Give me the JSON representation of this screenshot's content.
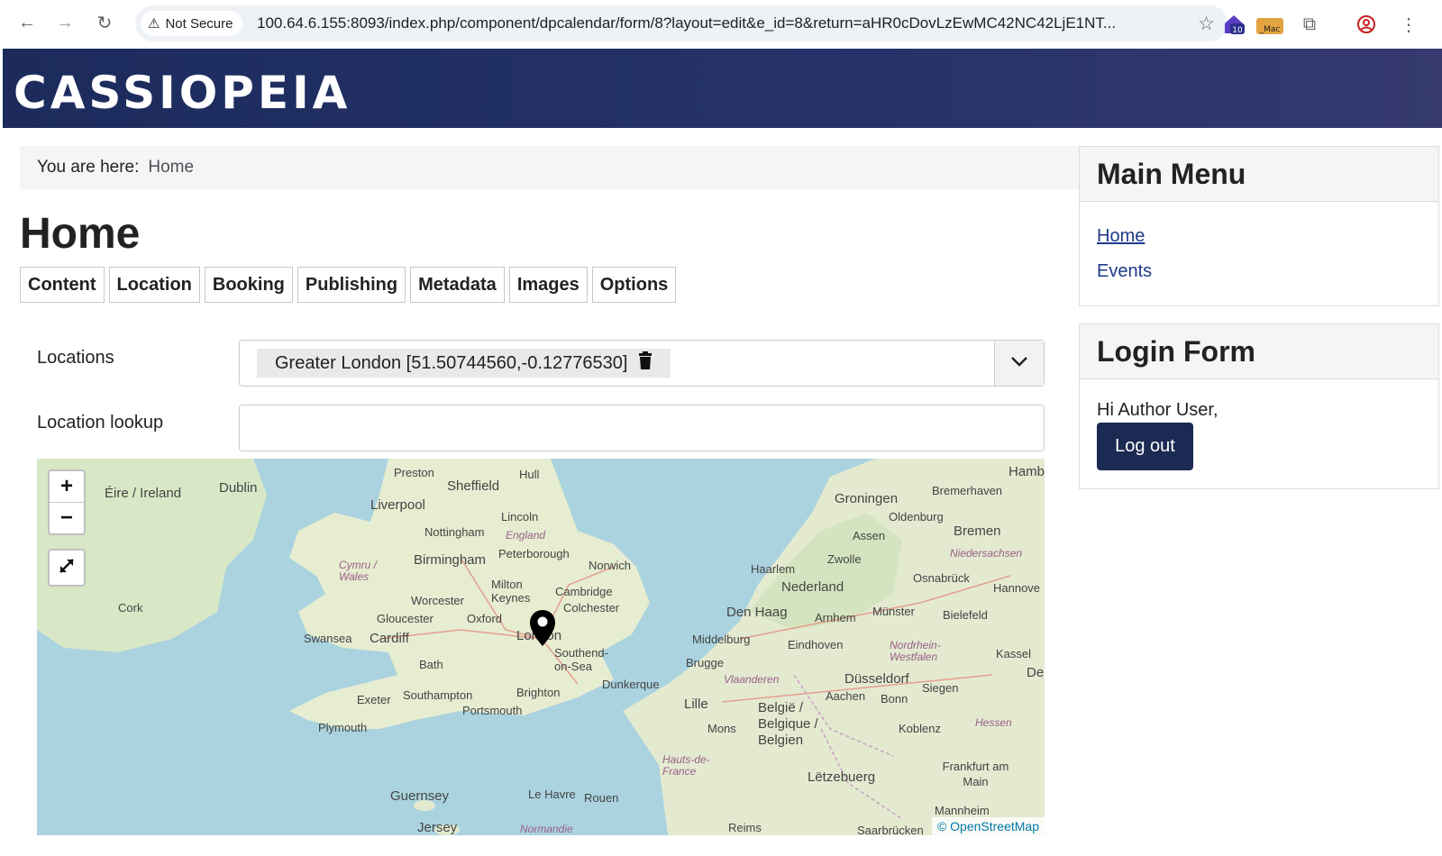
{
  "browser": {
    "security_label": "Not Secure",
    "url": "100.64.6.155:8093/index.php/component/dpcalendar/form/8?layout=edit&e_id=8&return=aHR0cDovLzEwMC42NC42LjE1NT...",
    "ext_badge_1": "10",
    "ext_badge_2": "_Mac"
  },
  "site": {
    "brand": "CASSIOPEIA"
  },
  "breadcrumb": {
    "label": "You are here:",
    "current": "Home"
  },
  "page": {
    "title": "Home"
  },
  "tabs": [
    {
      "label": "Content"
    },
    {
      "label": "Location"
    },
    {
      "label": "Booking"
    },
    {
      "label": "Publishing"
    },
    {
      "label": "Metadata"
    },
    {
      "label": "Images"
    },
    {
      "label": "Options"
    }
  ],
  "form": {
    "locations_label": "Locations",
    "selected_location": "Greater London [51.50744560,-0.12776530]",
    "lookup_label": "Location lookup",
    "lookup_value": ""
  },
  "map": {
    "zoom_in": "+",
    "zoom_out": "−",
    "attribution": "© OpenStreetMap",
    "labels": {
      "eire": "Éire / Ireland",
      "dublin": "Dublin",
      "cork": "Cork",
      "preston": "Preston",
      "hull": "Hull",
      "sheffield": "Sheffield",
      "liverpool": "Liverpool",
      "lincoln": "Lincoln",
      "nottingham": "Nottingham",
      "england": "England",
      "peterborough": "Peterborough",
      "birmingham": "Birmingham",
      "norwich": "Norwich",
      "cymru": "Cymru / Wales",
      "milton": "Milton Keynes",
      "cambridge": "Cambridge",
      "worcester": "Worcester",
      "colchester": "Colchester",
      "gloucester": "Gloucester",
      "oxford": "Oxford",
      "swansea": "Swansea",
      "cardiff": "Cardiff",
      "london": "London",
      "southend": "Southend-on-Sea",
      "bath": "Bath",
      "brighton": "Brighton",
      "exeter": "Exeter",
      "southampton": "Southampton",
      "portsmouth": "Portsmouth",
      "dunkerque": "Dunkerque",
      "plymouth": "Plymouth",
      "guernsey": "Guernsey",
      "jersey": "Jersey",
      "lehavre": "Le Havre",
      "rouen": "Rouen",
      "normandie": "Normandie",
      "hauts": "Hauts-de-France",
      "lille": "Lille",
      "mons": "Mons",
      "brugge": "Brugge",
      "vlaanderen": "Vlaanderen",
      "belgie": "België / Belgique / Belgien",
      "middelburg": "Middelburg",
      "denhaag": "Den Haag",
      "haarlem": "Haarlem",
      "nederland": "Nederland",
      "arnhem": "Arnhem",
      "eindhoven": "Eindhoven",
      "groningen": "Groningen",
      "oldenburg": "Oldenburg",
      "bremerhaven": "Bremerhaven",
      "bremen": "Bremen",
      "assen": "Assen",
      "zwolle": "Zwolle",
      "niedersachsen": "Niedersachsen",
      "osnabruck": "Osnabrück",
      "hannover": "Hannove",
      "munster": "Münster",
      "bielefeld": "Bielefeld",
      "nrw": "Nordrhein-Westfalen",
      "kassel": "Kassel",
      "dusseldorf": "Düsseldorf",
      "aachen": "Aachen",
      "bonn": "Bonn",
      "siegen": "Siegen",
      "koblenz": "Koblenz",
      "hessen": "Hessen",
      "frankfurt": "Frankfurt am Main",
      "letzebuerg": "Lëtzebuerg",
      "mannheim": "Mannheim",
      "reims": "Reims",
      "saarbrucken": "Saarbrücken",
      "hamb": "Hamb",
      "de": "De"
    }
  },
  "sidebar": {
    "main_menu": {
      "title": "Main Menu",
      "items": [
        {
          "label": "Home"
        },
        {
          "label": "Events"
        }
      ]
    },
    "login_form": {
      "title": "Login Form",
      "greeting": "Hi Author User,",
      "logout_label": "Log out"
    }
  }
}
